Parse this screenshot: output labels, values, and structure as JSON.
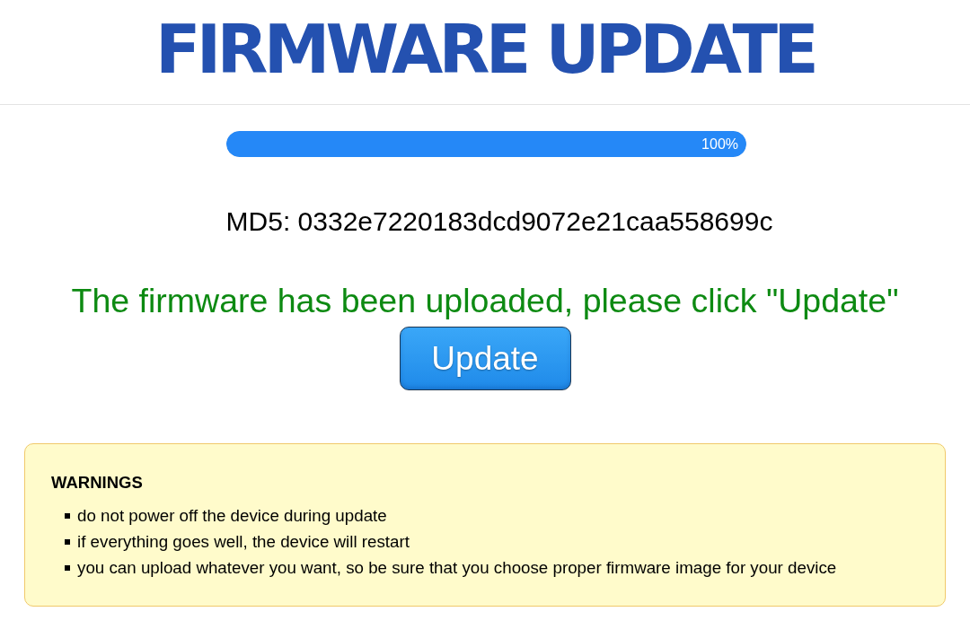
{
  "title": "FIRMWARE UPDATE",
  "progress": {
    "level": 1,
    "label": "100%"
  },
  "md5": "MD5: 0332e7220183dcd9072e21caa558699c",
  "status_message": "The firmware has been uploaded, please click \"Update\"",
  "update_button": {
    "label": "Update"
  },
  "warnings": {
    "title": "WARNINGS",
    "items": [
      "do not power off the device during update",
      "if everything goes well, the device will restart",
      "you can upload whatever you want, so be sure that you choose proper firmware image for your device"
    ]
  }
}
